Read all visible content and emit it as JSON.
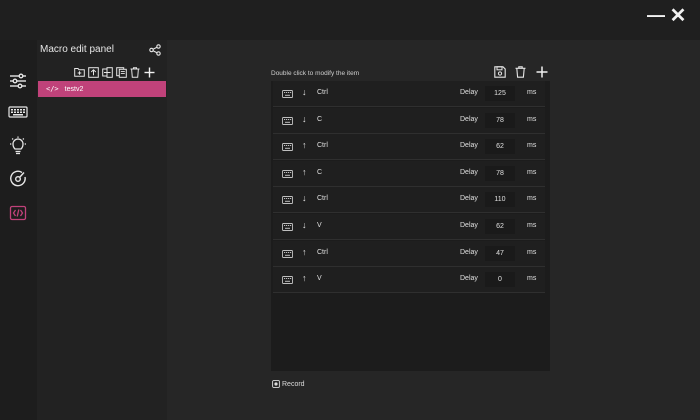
{
  "window": {
    "minimize_label": "—",
    "close_label": "✕"
  },
  "sidebar": {
    "items": [
      {
        "icon": "sliders-icon"
      },
      {
        "icon": "keyboard-icon"
      },
      {
        "icon": "lightbulb-icon"
      },
      {
        "icon": "disc-icon"
      },
      {
        "icon": "code-icon",
        "active": true
      }
    ],
    "active_color": "#c0427a"
  },
  "macro_panel": {
    "title": "Macro edit panel",
    "tools": [
      "folder-add-icon",
      "import-icon",
      "export-icon",
      "copy-icon",
      "delete-icon",
      "add-icon"
    ],
    "items": [
      {
        "label": "testv2",
        "selected": true
      }
    ]
  },
  "editor": {
    "hint": "Double click to modify the item",
    "tools": [
      "save-icon",
      "delete-icon",
      "add-icon"
    ],
    "events": [
      {
        "direction": "down",
        "key": "Ctrl",
        "delay_label": "Delay",
        "delay": "125",
        "unit": "ms"
      },
      {
        "direction": "down",
        "key": "C",
        "delay_label": "Delay",
        "delay": "78",
        "unit": "ms"
      },
      {
        "direction": "up",
        "key": "Ctrl",
        "delay_label": "Delay",
        "delay": "62",
        "unit": "ms"
      },
      {
        "direction": "up",
        "key": "C",
        "delay_label": "Delay",
        "delay": "78",
        "unit": "ms"
      },
      {
        "direction": "down",
        "key": "Ctrl",
        "delay_label": "Delay",
        "delay": "110",
        "unit": "ms"
      },
      {
        "direction": "down",
        "key": "V",
        "delay_label": "Delay",
        "delay": "62",
        "unit": "ms"
      },
      {
        "direction": "up",
        "key": "Ctrl",
        "delay_label": "Delay",
        "delay": "47",
        "unit": "ms"
      },
      {
        "direction": "up",
        "key": "V",
        "delay_label": "Delay",
        "delay": "0",
        "unit": "ms"
      }
    ],
    "record_label": "Record"
  }
}
